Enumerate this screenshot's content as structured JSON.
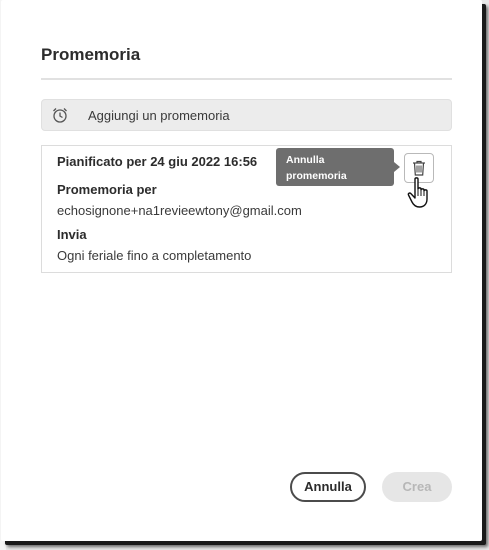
{
  "dialog": {
    "title": "Promemoria"
  },
  "add_reminder": {
    "label": "Aggiungi un promemoria",
    "icon": "alarm-clock-icon"
  },
  "reminder": {
    "scheduled": "Pianificato per 24 giu 2022 16:56",
    "recipient_heading": "Promemoria per",
    "recipient": "echosignone+na1revieewtony@gmail.com",
    "send_heading": "Invia",
    "send_value": "Ogni feriale fino a completamento",
    "delete_icon": "trash-icon",
    "tooltip": "Annulla promemoria"
  },
  "footer": {
    "cancel_label": "Annulla",
    "create_label": "Crea"
  },
  "colors": {
    "tooltip_bg": "#6e6e6e",
    "add_row_bg": "#ececec",
    "disabled_btn_bg": "#e6e6e6"
  }
}
